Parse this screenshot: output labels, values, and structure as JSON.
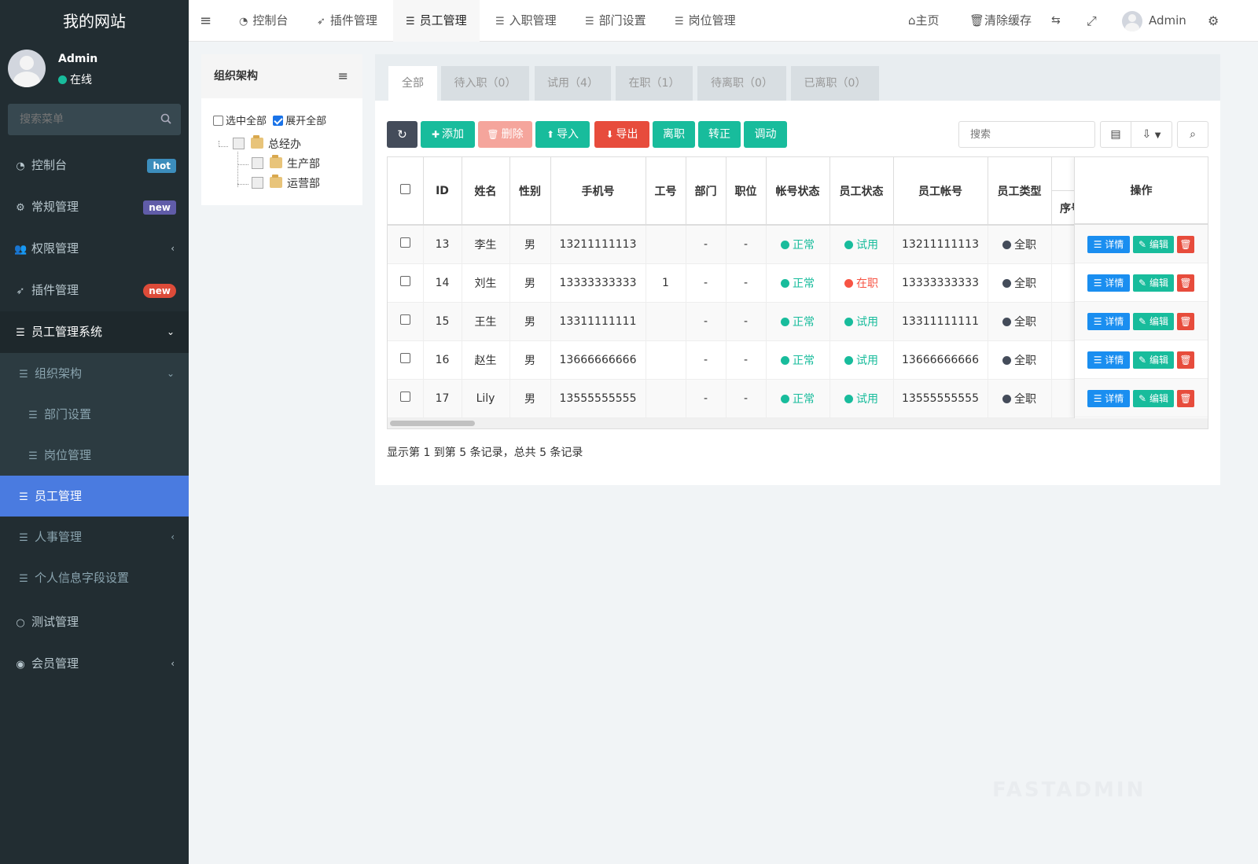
{
  "app": {
    "site_title": "我的网站"
  },
  "user": {
    "name": "Admin",
    "status": "在线"
  },
  "sidebar": {
    "search_placeholder": "搜索菜单",
    "items": [
      {
        "label": "控制台",
        "icon": "dashboard-icon",
        "badge": "hot",
        "badge_color": "#3c8dbc"
      },
      {
        "label": "常规管理",
        "icon": "cogs-icon",
        "badge": "new",
        "badge_color": "#605ca8"
      },
      {
        "label": "权限管理",
        "icon": "users-icon"
      },
      {
        "label": "插件管理",
        "icon": "rocket-icon",
        "badge": "new",
        "badge_color": "#dd4b39"
      },
      {
        "label": "员工管理系统",
        "icon": "list-icon"
      },
      {
        "label": "组织架构",
        "icon": "list-icon"
      },
      {
        "label": "部门设置",
        "icon": "list-icon"
      },
      {
        "label": "岗位管理",
        "icon": "list-icon"
      },
      {
        "label": "员工管理",
        "icon": "list-icon"
      },
      {
        "label": "人事管理",
        "icon": "list-icon"
      },
      {
        "label": "个人信息字段设置",
        "icon": "list-icon"
      },
      {
        "label": "测试管理",
        "icon": "circle-icon"
      },
      {
        "label": "会员管理",
        "icon": "user-circle-icon"
      }
    ]
  },
  "topnav": {
    "tabs": [
      {
        "label": "控制台",
        "icon": "dashboard-icon"
      },
      {
        "label": "插件管理",
        "icon": "rocket-icon"
      },
      {
        "label": "员工管理",
        "icon": "list-icon"
      },
      {
        "label": "入职管理",
        "icon": "list-icon"
      },
      {
        "label": "部门设置",
        "icon": "list-icon"
      },
      {
        "label": "岗位管理",
        "icon": "list-icon"
      }
    ],
    "home": "主页",
    "clear_cache": "清除缓存",
    "admin": "Admin"
  },
  "org": {
    "title": "组织架构",
    "select_all": "选中全部",
    "expand_all": "展开全部",
    "root": "总经办",
    "children": [
      "生产部",
      "运营部"
    ]
  },
  "tabs": [
    "全部",
    "待入职（0）",
    "试用（4）",
    "在职（1）",
    "待离职（0）",
    "已离职（0）"
  ],
  "toolbar": {
    "add": "添加",
    "delete": "删除",
    "import": "导入",
    "export": "导出",
    "resign": "离职",
    "regularize": "转正",
    "transfer": "调动",
    "search_placeholder": "搜索"
  },
  "table": {
    "headers": [
      "ID",
      "姓名",
      "性别",
      "手机号",
      "工号",
      "部门",
      "职位",
      "帐号状态",
      "员工状态",
      "员工帐号",
      "员工类型"
    ],
    "seq_header": "序号",
    "op_header": "操作",
    "rows": [
      {
        "id": "13",
        "name": "李生",
        "gender": "男",
        "phone": "13211111113",
        "no": "",
        "dept": "-",
        "pos": "-",
        "acct": "正常",
        "status": "试用",
        "status_color": "#18bc9c",
        "account": "13211111113",
        "type": "全职"
      },
      {
        "id": "14",
        "name": "刘生",
        "gender": "男",
        "phone": "13333333333",
        "no": "1",
        "dept": "-",
        "pos": "-",
        "acct": "正常",
        "status": "在职",
        "status_color": "#f75444",
        "account": "13333333333",
        "type": "全职"
      },
      {
        "id": "15",
        "name": "王生",
        "gender": "男",
        "phone": "13311111111",
        "no": "",
        "dept": "-",
        "pos": "-",
        "acct": "正常",
        "status": "试用",
        "status_color": "#18bc9c",
        "account": "13311111111",
        "type": "全职"
      },
      {
        "id": "16",
        "name": "赵生",
        "gender": "男",
        "phone": "13666666666",
        "no": "",
        "dept": "-",
        "pos": "-",
        "acct": "正常",
        "status": "试用",
        "status_color": "#18bc9c",
        "account": "13666666666",
        "type": "全职"
      },
      {
        "id": "17",
        "name": "Lily",
        "gender": "男",
        "phone": "13555555555",
        "no": "",
        "dept": "-",
        "pos": "-",
        "acct": "正常",
        "status": "试用",
        "status_color": "#18bc9c",
        "account": "13555555555",
        "type": "全职"
      }
    ],
    "row_actions": {
      "detail": "详情",
      "edit": "编辑"
    }
  },
  "pager": {
    "info": "显示第 1 到第 5 条记录，总共 5 条记录"
  },
  "watermark": "FASTADMIN",
  "colors": {
    "sidebar_bg": "#222d32",
    "active_menu": "#4a7be0",
    "primary": "#18bc9c",
    "danger": "#e74c3c",
    "info": "#1a8ef0",
    "dark_btn": "#444c5a"
  }
}
